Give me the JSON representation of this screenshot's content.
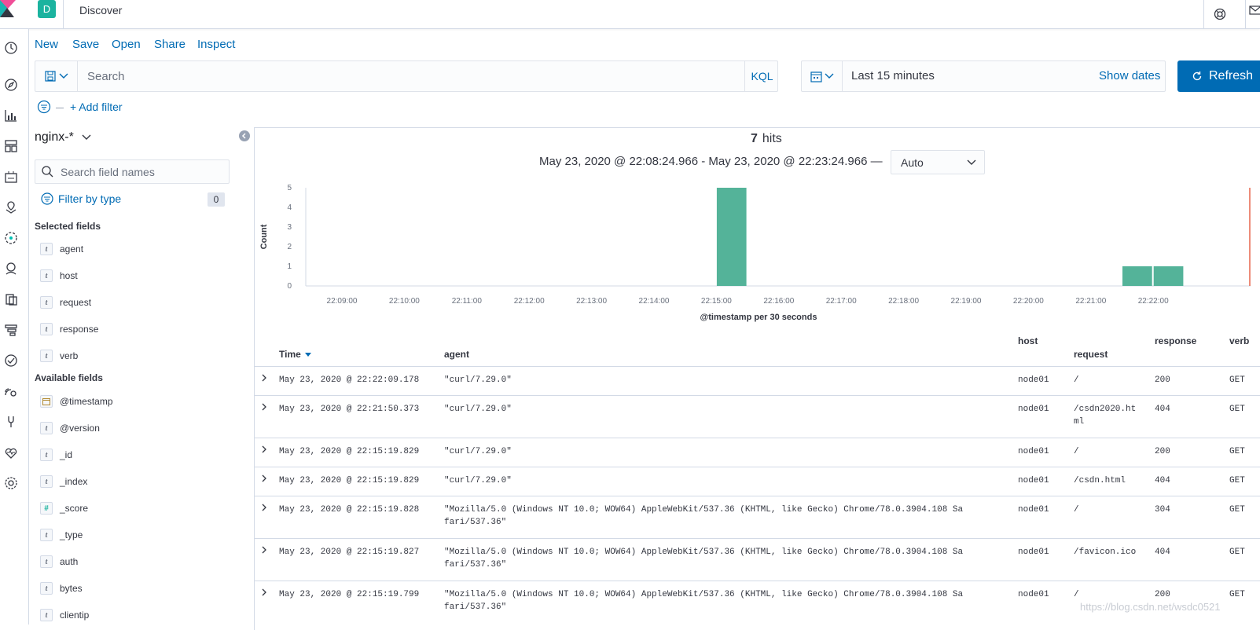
{
  "header": {
    "space_initial": "D",
    "app_title": "Discover"
  },
  "menu": {
    "new": "New",
    "save": "Save",
    "open": "Open",
    "share": "Share",
    "inspect": "Inspect"
  },
  "query": {
    "placeholder": "Search",
    "language": "KQL",
    "date_range": "Last 15 minutes",
    "show_dates": "Show dates",
    "refresh": "Refresh",
    "add_filter": "+ Add filter"
  },
  "sidebar": {
    "index_pattern": "nginx-*",
    "field_search_placeholder": "Search field names",
    "filter_by_type": "Filter by type",
    "filter_count": "0",
    "selected_title": "Selected fields",
    "selected_fields": [
      {
        "type": "t",
        "name": "agent"
      },
      {
        "type": "t",
        "name": "host"
      },
      {
        "type": "t",
        "name": "request"
      },
      {
        "type": "t",
        "name": "response"
      },
      {
        "type": "t",
        "name": "verb"
      }
    ],
    "available_title": "Available fields",
    "available_fields": [
      {
        "type": "date",
        "name": "@timestamp"
      },
      {
        "type": "t",
        "name": "@version"
      },
      {
        "type": "t",
        "name": "_id"
      },
      {
        "type": "t",
        "name": "_index"
      },
      {
        "type": "#",
        "name": "_score"
      },
      {
        "type": "t",
        "name": "_type"
      },
      {
        "type": "t",
        "name": "auth"
      },
      {
        "type": "t",
        "name": "bytes"
      },
      {
        "type": "t",
        "name": "clientip"
      }
    ]
  },
  "results": {
    "hits_count": "7",
    "hits_label": "hits",
    "time_range": "May 23, 2020 @ 22:08:24.966 - May 23, 2020 @ 22:23:24.966 —",
    "interval": "Auto"
  },
  "chart_data": {
    "type": "bar",
    "ylabel": "Count",
    "xlabel": "@timestamp per 30 seconds",
    "ylim": [
      0,
      5
    ],
    "yticks": [
      "0",
      "1",
      "2",
      "3",
      "4",
      "5"
    ],
    "xticks": [
      "22:09:00",
      "22:10:00",
      "22:11:00",
      "22:12:00",
      "22:13:00",
      "22:14:00",
      "22:15:00",
      "22:16:00",
      "22:17:00",
      "22:18:00",
      "22:19:00",
      "22:20:00",
      "22:21:00",
      "22:22:00"
    ],
    "bars": [
      {
        "x": "22:15:00",
        "value": 5
      },
      {
        "x": "22:21:30",
        "value": 1
      },
      {
        "x": "22:22:00",
        "value": 1
      }
    ],
    "bar_color": "#54b399",
    "now_marker_color": "#e7664c"
  },
  "table": {
    "headers": {
      "time": "Time",
      "agent": "agent",
      "host": "host",
      "request": "request",
      "response": "response",
      "verb": "verb"
    },
    "rows": [
      {
        "time": "May 23, 2020 @ 22:22:09.178",
        "agent": "\"curl/7.29.0\"",
        "host": "node01",
        "request": "/",
        "response": "200",
        "verb": "GET"
      },
      {
        "time": "May 23, 2020 @ 22:21:50.373",
        "agent": "\"curl/7.29.0\"",
        "host": "node01",
        "request": "/csdn2020.ht\nml",
        "response": "404",
        "verb": "GET"
      },
      {
        "time": "May 23, 2020 @ 22:15:19.829",
        "agent": "\"curl/7.29.0\"",
        "host": "node01",
        "request": "/",
        "response": "200",
        "verb": "GET"
      },
      {
        "time": "May 23, 2020 @ 22:15:19.829",
        "agent": "\"curl/7.29.0\"",
        "host": "node01",
        "request": "/csdn.html",
        "response": "404",
        "verb": "GET"
      },
      {
        "time": "May 23, 2020 @ 22:15:19.828",
        "agent": "\"Mozilla/5.0 (Windows NT 10.0; WOW64) AppleWebKit/537.36 (KHTML, like Gecko) Chrome/78.0.3904.108 Sa\nfari/537.36\"",
        "host": "node01",
        "request": "/",
        "response": "304",
        "verb": "GET"
      },
      {
        "time": "May 23, 2020 @ 22:15:19.827",
        "agent": "\"Mozilla/5.0 (Windows NT 10.0; WOW64) AppleWebKit/537.36 (KHTML, like Gecko) Chrome/78.0.3904.108 Sa\nfari/537.36\"",
        "host": "node01",
        "request": "/favicon.ico",
        "response": "404",
        "verb": "GET"
      },
      {
        "time": "May 23, 2020 @ 22:15:19.799",
        "agent": "\"Mozilla/5.0 (Windows NT 10.0; WOW64) AppleWebKit/537.36 (KHTML, like Gecko) Chrome/78.0.3904.108 Sa\nfari/537.36\"",
        "host": "node01",
        "request": "/",
        "response": "200",
        "verb": "GET"
      }
    ]
  },
  "watermark": "https://blog.csdn.net/wsdc0521",
  "colors": {
    "accent": "#006bb4",
    "space_badge": "#1bb39f",
    "border": "#d3dae6"
  }
}
